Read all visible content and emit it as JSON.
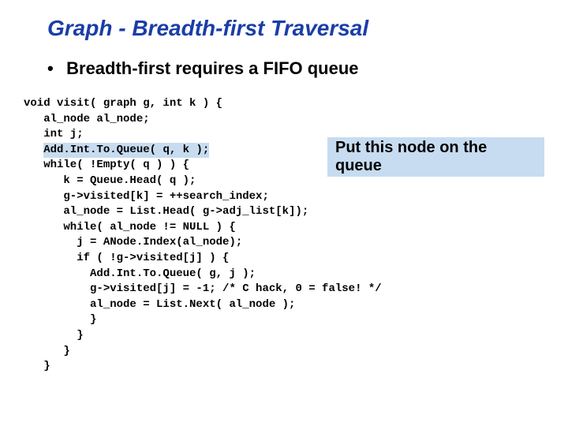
{
  "title": "Graph - Breadth-first Traversal",
  "bullet": "Breadth-first requires a FIFO queue",
  "callout": "Put this node on the queue",
  "code": {
    "l01": "void visit( graph g, int k ) {",
    "l02": "   al_node al_node;",
    "l03": "   int j;",
    "l04a": "   ",
    "l04b": "Add.Int.To.Queue( q, k );",
    "l05": "   while( !Empty( q ) ) {",
    "l06": "      k = Queue.Head( q );",
    "l07": "      g->visited[k] = ++search_index;",
    "l08": "      al_node = List.Head( g->adj_list[k]);",
    "l09": "      while( al_node != NULL ) {",
    "l10": "        j = ANode.Index(al_node);",
    "l11": "        if ( !g->visited[j] ) {",
    "l12": "          Add.Int.To.Queue( g, j );",
    "l13": "          g->visited[j] = -1; /* C hack, 0 = false! */",
    "l14": "          al_node = List.Next( al_node );",
    "l15": "          }",
    "l16": "        }",
    "l17": "      }",
    "l18": "   }"
  }
}
